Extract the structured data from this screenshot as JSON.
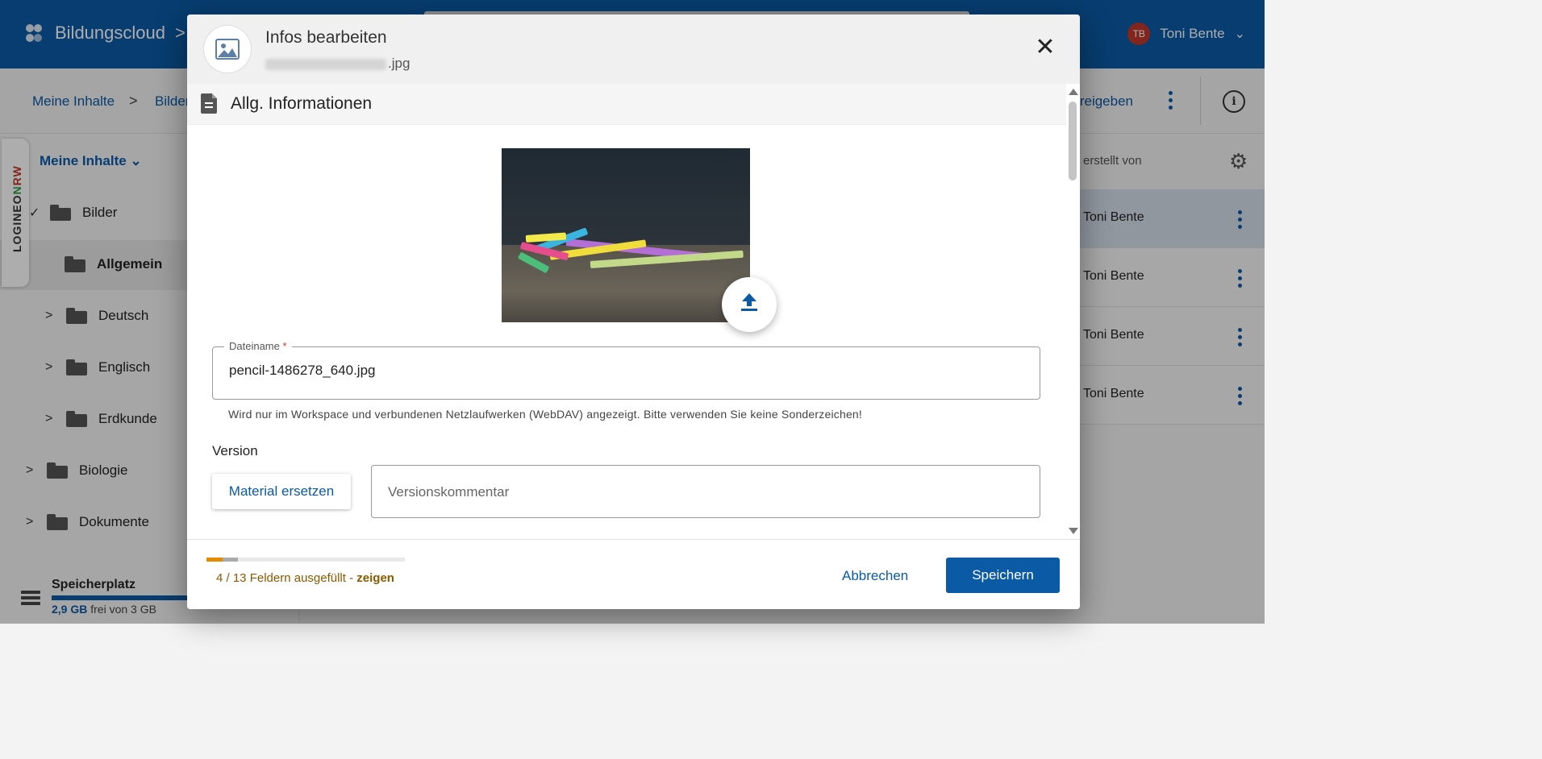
{
  "app": {
    "brand": "Bildungscloud",
    "user_initials": "TB",
    "user_name": "Toni Bente"
  },
  "toolbar": {
    "breadcrumb_1": "Meine Inhalte",
    "breadcrumb_2": "Bilder",
    "share_label": "reigeben"
  },
  "sidebar": {
    "title": "Meine Inhalte",
    "items": [
      {
        "label": "Bilder"
      },
      {
        "label": "Allgemein"
      },
      {
        "label": "Deutsch"
      },
      {
        "label": "Englisch"
      },
      {
        "label": "Erdkunde"
      },
      {
        "label": "Biologie"
      },
      {
        "label": "Dokumente"
      }
    ],
    "storage_title": "Speicherplatz",
    "storage_used": "2,9 GB",
    "storage_rest": " frei von 3 GB",
    "storage_fraction": 0.97,
    "logineo_a": "LOGINEO",
    "logineo_n": "N",
    "logineo_rw": "RW"
  },
  "table": {
    "column": "erstellt von",
    "rows": [
      {
        "creator": "Toni Bente"
      },
      {
        "creator": "Toni Bente"
      },
      {
        "creator": "Toni Bente"
      },
      {
        "creator": "Toni Bente"
      }
    ]
  },
  "modal": {
    "title": "Infos bearbeiten",
    "subtitle_ext": ".jpg",
    "section_title": "Allg. Informationen",
    "filename_label": "Dateiname",
    "required_mark": "*",
    "filename_value": "pencil-1486278_640.jpg",
    "filename_hint": "Wird nur im Workspace und verbundenen Netzlaufwerken (WebDAV) angezeigt. Bitte verwenden Sie keine Sonderzeichen!",
    "version_label": "Version",
    "replace_button": "Material ersetzen",
    "version_placeholder": "Versionskommentar",
    "progress_text": "4 / 13 Feldern ausgefüllt - ",
    "progress_link": "zeigen",
    "progress_fraction": 0.08,
    "cancel_button": "Abbrechen",
    "save_button": "Speichern"
  }
}
